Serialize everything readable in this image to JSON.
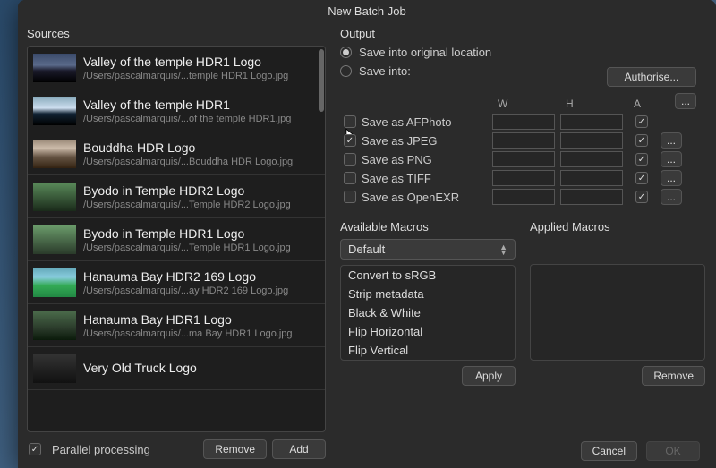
{
  "window": {
    "title": "New Batch Job"
  },
  "sources": {
    "label": "Sources",
    "items": [
      {
        "title": "Valley of the temple HDR1 Logo",
        "path": "/Users/pascalmarquis/...temple HDR1 Logo.jpg"
      },
      {
        "title": "Valley of the temple HDR1",
        "path": "/Users/pascalmarquis/...of the temple HDR1.jpg"
      },
      {
        "title": "Bouddha HDR Logo",
        "path": "/Users/pascalmarquis/...Bouddha HDR Logo.jpg"
      },
      {
        "title": "Byodo in Temple HDR2 Logo",
        "path": "/Users/pascalmarquis/...Temple HDR2 Logo.jpg"
      },
      {
        "title": "Byodo in Temple HDR1 Logo",
        "path": "/Users/pascalmarquis/...Temple HDR1 Logo.jpg"
      },
      {
        "title": "Hanauma Bay HDR2 169 Logo",
        "path": "/Users/pascalmarquis/...ay HDR2 169 Logo.jpg"
      },
      {
        "title": "Hanauma Bay HDR1 Logo",
        "path": "/Users/pascalmarquis/...ma Bay HDR1 Logo.jpg"
      },
      {
        "title": "Very Old Truck Logo",
        "path": ""
      }
    ],
    "parallel_label": "Parallel processing",
    "remove_label": "Remove",
    "add_label": "Add"
  },
  "output": {
    "label": "Output",
    "radio_original": "Save into original location",
    "radio_saveinto": "Save into:",
    "authorise_label": "Authorise...",
    "browse_label": "...",
    "col_w": "W",
    "col_h": "H",
    "col_a": "A",
    "formats": [
      {
        "label": "Save as AFPhoto",
        "checked": false,
        "opts": false
      },
      {
        "label": "Save as JPEG",
        "checked": true,
        "opts": true
      },
      {
        "label": "Save as PNG",
        "checked": false,
        "opts": true
      },
      {
        "label": "Save as TIFF",
        "checked": false,
        "opts": true
      },
      {
        "label": "Save as OpenEXR",
        "checked": false,
        "opts": true
      }
    ],
    "opts_label": "..."
  },
  "macros": {
    "available_label": "Available Macros",
    "applied_label": "Applied Macros",
    "dropdown_value": "Default",
    "available": [
      "Convert to sRGB",
      "Strip metadata",
      "Black & White",
      "Flip Horizontal",
      "Flip Vertical"
    ],
    "apply_label": "Apply",
    "remove_label": "Remove"
  },
  "footer": {
    "cancel_label": "Cancel",
    "ok_label": "OK"
  }
}
